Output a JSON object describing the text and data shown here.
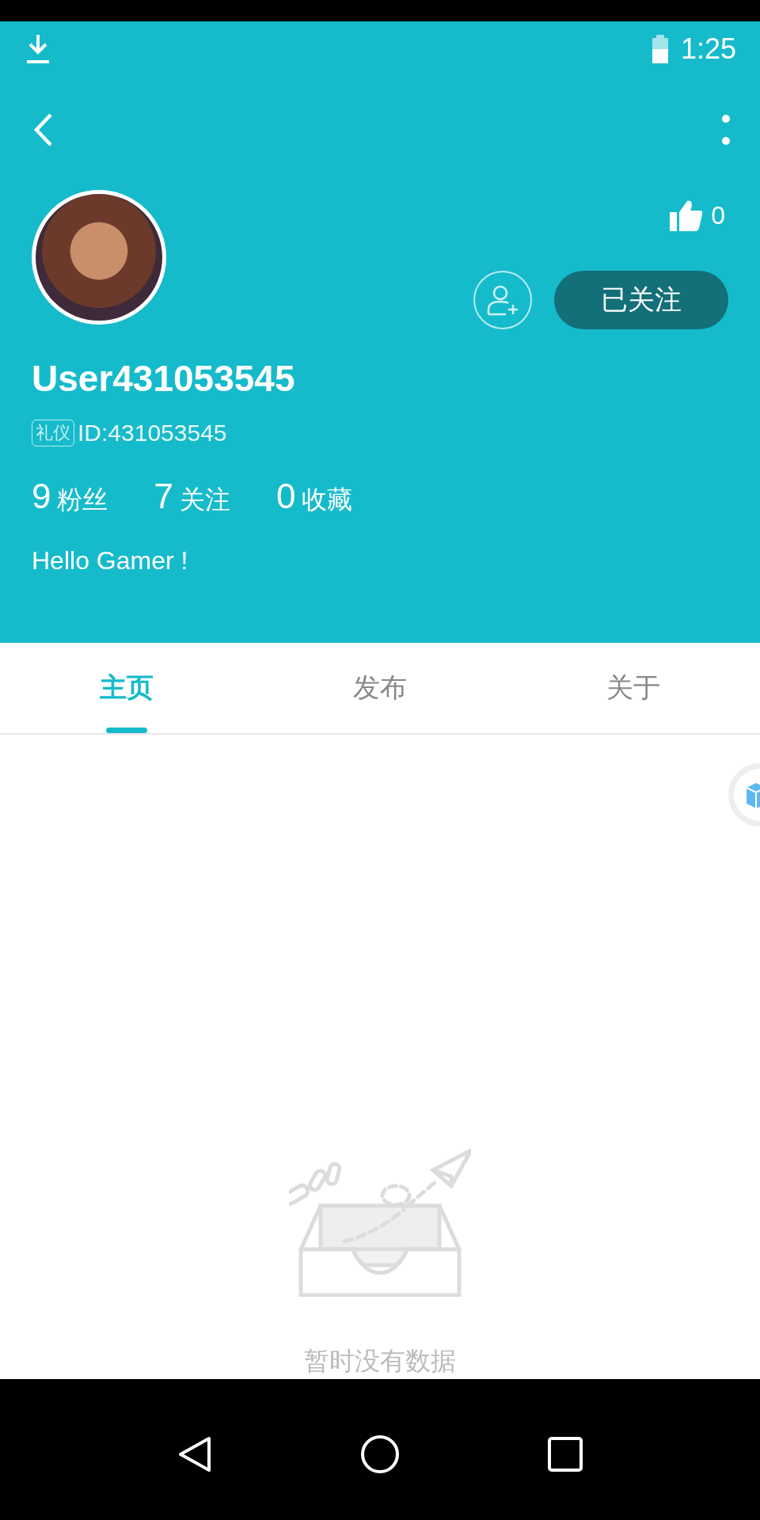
{
  "status_bar": {
    "time": "1:25"
  },
  "profile": {
    "likes": "0",
    "follow_button": "已关注",
    "followed": true,
    "username": "User431053545",
    "badge": "礼仪",
    "id": "ID:431053545",
    "stats": [
      {
        "count": "9",
        "name": "粉丝"
      },
      {
        "count": "7",
        "name": "关注"
      },
      {
        "count": "0",
        "name": "收藏"
      }
    ],
    "bio": "Hello Gamer !"
  },
  "tabs": [
    {
      "label": "主页",
      "selected": true
    },
    {
      "label": "发布",
      "selected": false
    },
    {
      "label": "关于",
      "selected": false
    }
  ],
  "empty_state": {
    "message": "暂时没有数据"
  }
}
